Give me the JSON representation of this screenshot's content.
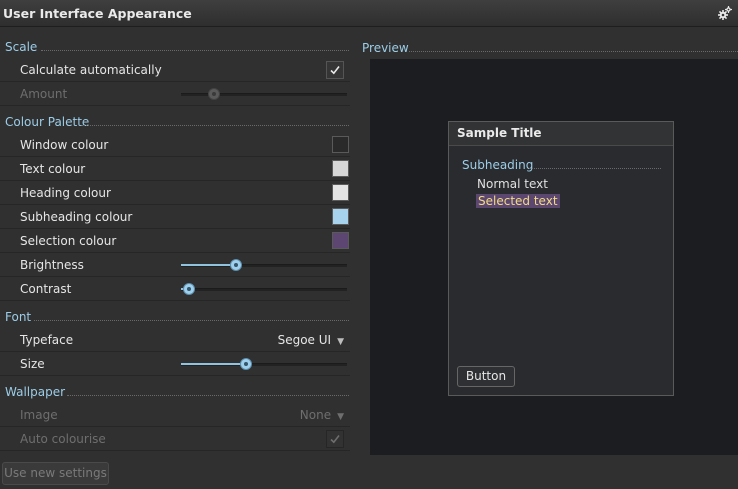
{
  "window": {
    "title": "User Interface Appearance",
    "icon": "gears-icon"
  },
  "sections": {
    "scale": {
      "label": "Scale",
      "calculate_label": "Calculate automatically",
      "calculate_checked": true,
      "amount_label": "Amount",
      "amount_value": 0.2
    },
    "palette": {
      "label": "Colour Palette",
      "window_colour_label": "Window colour",
      "window_colour": "#2a2a2a",
      "text_colour_label": "Text colour",
      "text_colour": "#d7d7d7",
      "heading_colour_label": "Heading colour",
      "heading_colour": "#e4e4e4",
      "subheading_colour_label": "Subheading colour",
      "subheading_colour": "#a7d3ef",
      "selection_colour_label": "Selection colour",
      "selection_colour": "#5e4673",
      "brightness_label": "Brightness",
      "brightness_value": 0.33,
      "contrast_label": "Contrast",
      "contrast_value": 0.05
    },
    "font": {
      "label": "Font",
      "typeface_label": "Typeface",
      "typeface_value": "Segoe UI",
      "size_label": "Size",
      "size_value": 0.39
    },
    "wallpaper": {
      "label": "Wallpaper",
      "image_label": "Image",
      "image_value": "None",
      "auto_colourise_label": "Auto colourise",
      "auto_colourise_checked": true
    }
  },
  "apply_button": "Use new settings",
  "preview": {
    "label": "Preview",
    "sample_title": "Sample Title",
    "subheading": "Subheading",
    "normal_text": "Normal text",
    "selected_text": "Selected text",
    "button": "Button"
  }
}
